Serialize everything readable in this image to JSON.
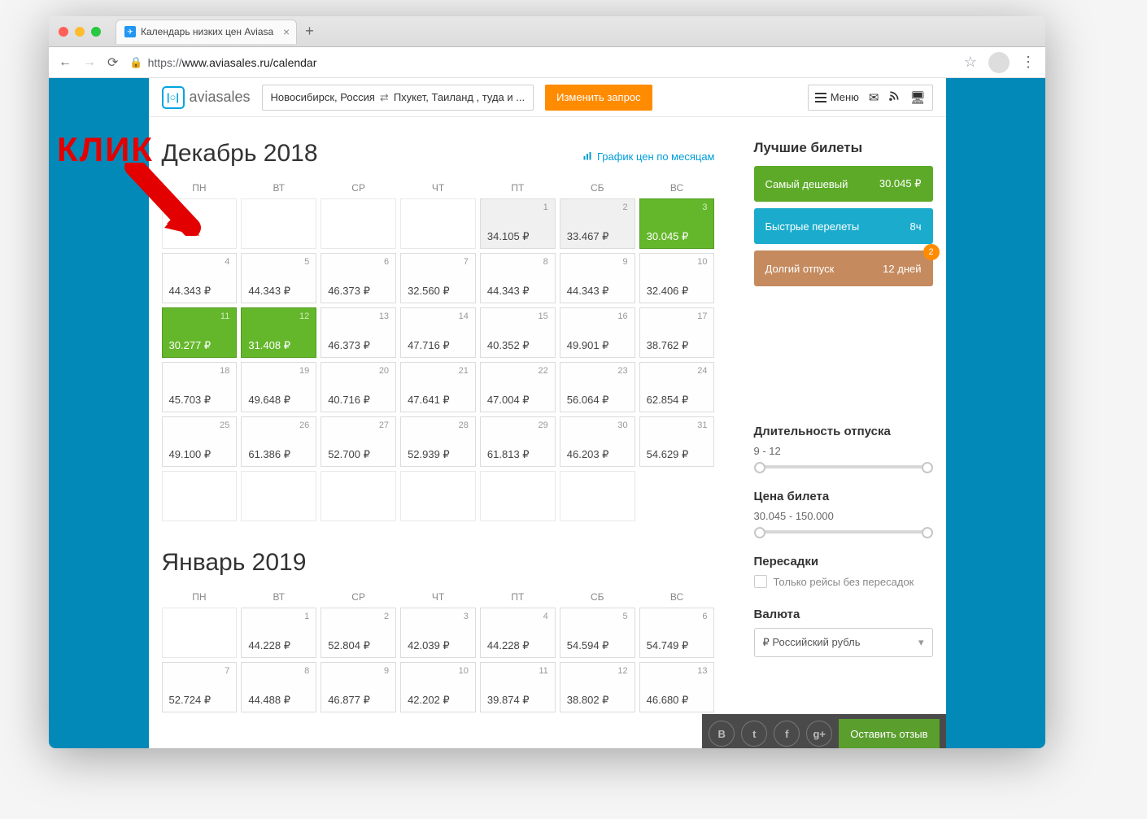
{
  "browser": {
    "tab_title": "Календарь низких цен Aviasa",
    "tab_plus": "+",
    "url_prefix": "https://",
    "url_rest": "www.aviasales.ru/calendar"
  },
  "header": {
    "logo_text": "aviasales",
    "route_from": "Новосибирск, Россия",
    "route_to": "Пхукет, Таиланд , туда и ...",
    "change_button": "Изменить запрос",
    "menu_label": "Меню"
  },
  "annotation": {
    "click_label": "КЛИК"
  },
  "chart_link_label": "График цен по месяцам",
  "weekdays": [
    "ПН",
    "ВТ",
    "СР",
    "ЧТ",
    "ПТ",
    "СБ",
    "ВС"
  ],
  "months": [
    {
      "title": "Декабрь 2018",
      "lead_blanks": 4,
      "days": [
        {
          "n": 1,
          "price": "34.105 ₽",
          "state": "past"
        },
        {
          "n": 2,
          "price": "33.467 ₽",
          "state": "past"
        },
        {
          "n": 3,
          "price": "30.045 ₽",
          "state": "green"
        },
        {
          "n": 4,
          "price": "44.343 ₽"
        },
        {
          "n": 5,
          "price": "44.343 ₽"
        },
        {
          "n": 6,
          "price": "46.373 ₽"
        },
        {
          "n": 7,
          "price": "32.560 ₽"
        },
        {
          "n": 8,
          "price": "44.343 ₽"
        },
        {
          "n": 9,
          "price": "44.343 ₽"
        },
        {
          "n": 10,
          "price": "32.406 ₽"
        },
        {
          "n": 11,
          "price": "30.277 ₽",
          "state": "green"
        },
        {
          "n": 12,
          "price": "31.408 ₽",
          "state": "green"
        },
        {
          "n": 13,
          "price": "46.373 ₽"
        },
        {
          "n": 14,
          "price": "47.716 ₽"
        },
        {
          "n": 15,
          "price": "40.352 ₽"
        },
        {
          "n": 16,
          "price": "49.901 ₽"
        },
        {
          "n": 17,
          "price": "38.762 ₽"
        },
        {
          "n": 18,
          "price": "45.703 ₽"
        },
        {
          "n": 19,
          "price": "49.648 ₽"
        },
        {
          "n": 20,
          "price": "40.716 ₽"
        },
        {
          "n": 21,
          "price": "47.641 ₽"
        },
        {
          "n": 22,
          "price": "47.004 ₽"
        },
        {
          "n": 23,
          "price": "56.064 ₽"
        },
        {
          "n": 24,
          "price": "62.854 ₽"
        },
        {
          "n": 25,
          "price": "49.100 ₽"
        },
        {
          "n": 26,
          "price": "61.386 ₽"
        },
        {
          "n": 27,
          "price": "52.700 ₽"
        },
        {
          "n": 28,
          "price": "52.939 ₽"
        },
        {
          "n": 29,
          "price": "61.813 ₽"
        },
        {
          "n": 30,
          "price": "46.203 ₽"
        },
        {
          "n": 31,
          "price": "54.629 ₽"
        }
      ],
      "tail_blanks": 6
    },
    {
      "title": "Январь 2019",
      "lead_blanks": 0,
      "days": [
        {
          "n": 1,
          "price": "44.228 ₽"
        },
        {
          "n": 2,
          "price": "52.804 ₽"
        },
        {
          "n": 3,
          "price": "42.039 ₽"
        },
        {
          "n": 4,
          "price": "44.228 ₽"
        },
        {
          "n": 5,
          "price": "54.594 ₽"
        },
        {
          "n": 6,
          "price": "54.749 ₽"
        },
        {
          "n": 7,
          "price": "52.724 ₽"
        },
        {
          "n": 8,
          "price": "44.488 ₽"
        },
        {
          "n": 9,
          "price": "46.877 ₽"
        },
        {
          "n": 10,
          "price": "42.202 ₽"
        },
        {
          "n": 11,
          "price": "39.874 ₽"
        },
        {
          "n": 12,
          "price": "38.802 ₽"
        },
        {
          "n": 13,
          "price": "46.680 ₽"
        }
      ],
      "tail_blanks": 0,
      "first_empty": true
    }
  ],
  "sidebar": {
    "best_tickets_title": "Лучшие билеты",
    "cheapest_label": "Самый дешевый",
    "cheapest_value": "30.045 ₽",
    "fast_label": "Быстрые перелеты",
    "fast_value": "8ч",
    "long_label": "Долгий отпуск",
    "long_value": "12 дней",
    "long_badge": "2",
    "duration_title": "Длительность отпуска",
    "duration_value": "9 - 12",
    "price_title": "Цена билета",
    "price_value": "30.045 - 150.000",
    "transfers_title": "Пересадки",
    "transfers_checkbox": "Только рейсы без пересадок",
    "currency_title": "Валюта",
    "currency_value": "₽ Российский рубль"
  },
  "footer": {
    "feedback": "Оставить отзыв"
  }
}
